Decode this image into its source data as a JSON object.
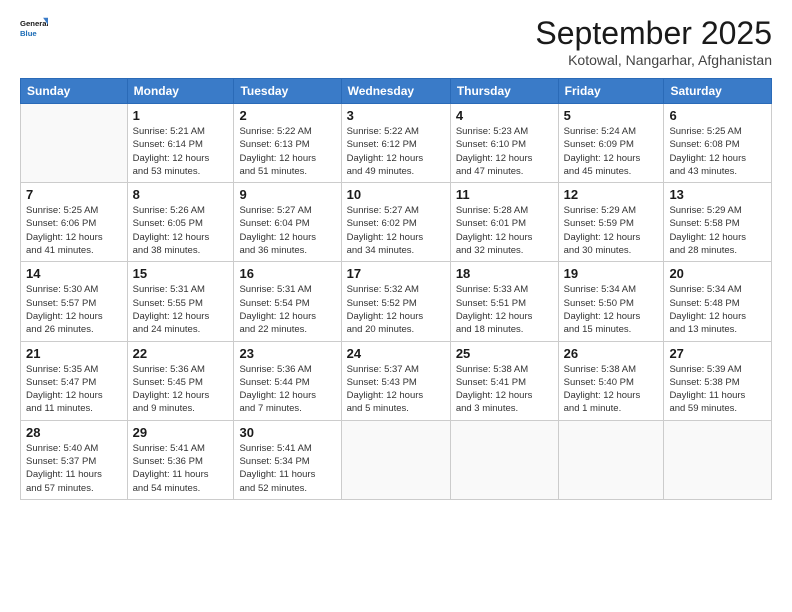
{
  "logo": {
    "line1": "General",
    "line2": "Blue"
  },
  "title": "September 2025",
  "subtitle": "Kotowal, Nangarhar, Afghanistan",
  "headers": [
    "Sunday",
    "Monday",
    "Tuesday",
    "Wednesday",
    "Thursday",
    "Friday",
    "Saturday"
  ],
  "weeks": [
    [
      {
        "day": "",
        "info": ""
      },
      {
        "day": "1",
        "info": "Sunrise: 5:21 AM\nSunset: 6:14 PM\nDaylight: 12 hours\nand 53 minutes."
      },
      {
        "day": "2",
        "info": "Sunrise: 5:22 AM\nSunset: 6:13 PM\nDaylight: 12 hours\nand 51 minutes."
      },
      {
        "day": "3",
        "info": "Sunrise: 5:22 AM\nSunset: 6:12 PM\nDaylight: 12 hours\nand 49 minutes."
      },
      {
        "day": "4",
        "info": "Sunrise: 5:23 AM\nSunset: 6:10 PM\nDaylight: 12 hours\nand 47 minutes."
      },
      {
        "day": "5",
        "info": "Sunrise: 5:24 AM\nSunset: 6:09 PM\nDaylight: 12 hours\nand 45 minutes."
      },
      {
        "day": "6",
        "info": "Sunrise: 5:25 AM\nSunset: 6:08 PM\nDaylight: 12 hours\nand 43 minutes."
      }
    ],
    [
      {
        "day": "7",
        "info": "Sunrise: 5:25 AM\nSunset: 6:06 PM\nDaylight: 12 hours\nand 41 minutes."
      },
      {
        "day": "8",
        "info": "Sunrise: 5:26 AM\nSunset: 6:05 PM\nDaylight: 12 hours\nand 38 minutes."
      },
      {
        "day": "9",
        "info": "Sunrise: 5:27 AM\nSunset: 6:04 PM\nDaylight: 12 hours\nand 36 minutes."
      },
      {
        "day": "10",
        "info": "Sunrise: 5:27 AM\nSunset: 6:02 PM\nDaylight: 12 hours\nand 34 minutes."
      },
      {
        "day": "11",
        "info": "Sunrise: 5:28 AM\nSunset: 6:01 PM\nDaylight: 12 hours\nand 32 minutes."
      },
      {
        "day": "12",
        "info": "Sunrise: 5:29 AM\nSunset: 5:59 PM\nDaylight: 12 hours\nand 30 minutes."
      },
      {
        "day": "13",
        "info": "Sunrise: 5:29 AM\nSunset: 5:58 PM\nDaylight: 12 hours\nand 28 minutes."
      }
    ],
    [
      {
        "day": "14",
        "info": "Sunrise: 5:30 AM\nSunset: 5:57 PM\nDaylight: 12 hours\nand 26 minutes."
      },
      {
        "day": "15",
        "info": "Sunrise: 5:31 AM\nSunset: 5:55 PM\nDaylight: 12 hours\nand 24 minutes."
      },
      {
        "day": "16",
        "info": "Sunrise: 5:31 AM\nSunset: 5:54 PM\nDaylight: 12 hours\nand 22 minutes."
      },
      {
        "day": "17",
        "info": "Sunrise: 5:32 AM\nSunset: 5:52 PM\nDaylight: 12 hours\nand 20 minutes."
      },
      {
        "day": "18",
        "info": "Sunrise: 5:33 AM\nSunset: 5:51 PM\nDaylight: 12 hours\nand 18 minutes."
      },
      {
        "day": "19",
        "info": "Sunrise: 5:34 AM\nSunset: 5:50 PM\nDaylight: 12 hours\nand 15 minutes."
      },
      {
        "day": "20",
        "info": "Sunrise: 5:34 AM\nSunset: 5:48 PM\nDaylight: 12 hours\nand 13 minutes."
      }
    ],
    [
      {
        "day": "21",
        "info": "Sunrise: 5:35 AM\nSunset: 5:47 PM\nDaylight: 12 hours\nand 11 minutes."
      },
      {
        "day": "22",
        "info": "Sunrise: 5:36 AM\nSunset: 5:45 PM\nDaylight: 12 hours\nand 9 minutes."
      },
      {
        "day": "23",
        "info": "Sunrise: 5:36 AM\nSunset: 5:44 PM\nDaylight: 12 hours\nand 7 minutes."
      },
      {
        "day": "24",
        "info": "Sunrise: 5:37 AM\nSunset: 5:43 PM\nDaylight: 12 hours\nand 5 minutes."
      },
      {
        "day": "25",
        "info": "Sunrise: 5:38 AM\nSunset: 5:41 PM\nDaylight: 12 hours\nand 3 minutes."
      },
      {
        "day": "26",
        "info": "Sunrise: 5:38 AM\nSunset: 5:40 PM\nDaylight: 12 hours\nand 1 minute."
      },
      {
        "day": "27",
        "info": "Sunrise: 5:39 AM\nSunset: 5:38 PM\nDaylight: 11 hours\nand 59 minutes."
      }
    ],
    [
      {
        "day": "28",
        "info": "Sunrise: 5:40 AM\nSunset: 5:37 PM\nDaylight: 11 hours\nand 57 minutes."
      },
      {
        "day": "29",
        "info": "Sunrise: 5:41 AM\nSunset: 5:36 PM\nDaylight: 11 hours\nand 54 minutes."
      },
      {
        "day": "30",
        "info": "Sunrise: 5:41 AM\nSunset: 5:34 PM\nDaylight: 11 hours\nand 52 minutes."
      },
      {
        "day": "",
        "info": ""
      },
      {
        "day": "",
        "info": ""
      },
      {
        "day": "",
        "info": ""
      },
      {
        "day": "",
        "info": ""
      }
    ]
  ]
}
